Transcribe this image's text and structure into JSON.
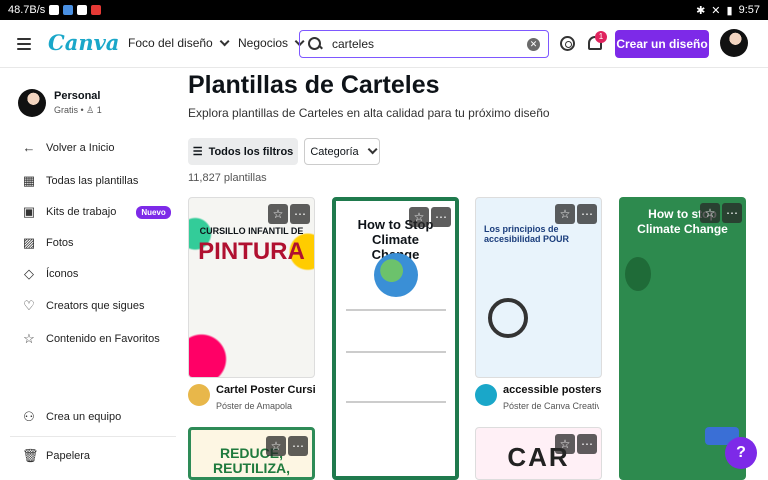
{
  "status_bar": {
    "speed": "48.7B/s",
    "time": "9:57"
  },
  "header": {
    "logo": "Canva",
    "nav": [
      {
        "label": "Foco del diseño"
      },
      {
        "label": "Negocios"
      }
    ],
    "search_value": "carteles",
    "notification_count": "1",
    "create_label": "Crear un diseño"
  },
  "sidebar": {
    "team_name": "Personal",
    "team_plan": "Gratis",
    "team_members": "1",
    "items": [
      {
        "label": "Volver a Inicio",
        "icon": "arrow-left-icon"
      },
      {
        "label": "Todas las plantillas",
        "icon": "template-icon"
      },
      {
        "label": "Kits de trabajo",
        "icon": "briefcase-icon",
        "badge": "Nuevo"
      },
      {
        "label": "Fotos",
        "icon": "photo-icon"
      },
      {
        "label": "Íconos",
        "icon": "shapes-icon"
      },
      {
        "label": "Creators que sigues",
        "icon": "heart-icon"
      },
      {
        "label": "Contenido en Favoritos",
        "icon": "star-icon"
      }
    ],
    "footer": [
      {
        "label": "Crea un equipo",
        "icon": "team-icon"
      },
      {
        "label": "Papelera",
        "icon": "trash-icon"
      }
    ]
  },
  "main": {
    "title": "Plantillas de Carteles",
    "subtitle": "Explora plantillas de Carteles en alta calidad para tu próximo diseño",
    "filter_label": "Todos los filtros",
    "category_label": "Categoría",
    "count": "11,827 plantillas",
    "cards": [
      {
        "title": "Cartel Poster Cursill…",
        "author": "Póster de Amapola",
        "poster_heading": "CURSILLO INFANTIL DE",
        "poster_big": "PINTURA"
      },
      {
        "poster_heading": "How to Stop Climate Change"
      },
      {
        "title": "accessible posters",
        "author": "Póster de Canva Creativ…",
        "poster_heading": "Los principios de accesibilidad POUR"
      },
      {
        "poster_heading": "How to stop Climate Change"
      },
      {
        "poster_heading": "REDUCE, REUTILIZA,"
      },
      {
        "poster_heading": "CAR"
      }
    ]
  },
  "colors": {
    "accent": "#7d2ae8",
    "logo": "#1aa7c9"
  }
}
